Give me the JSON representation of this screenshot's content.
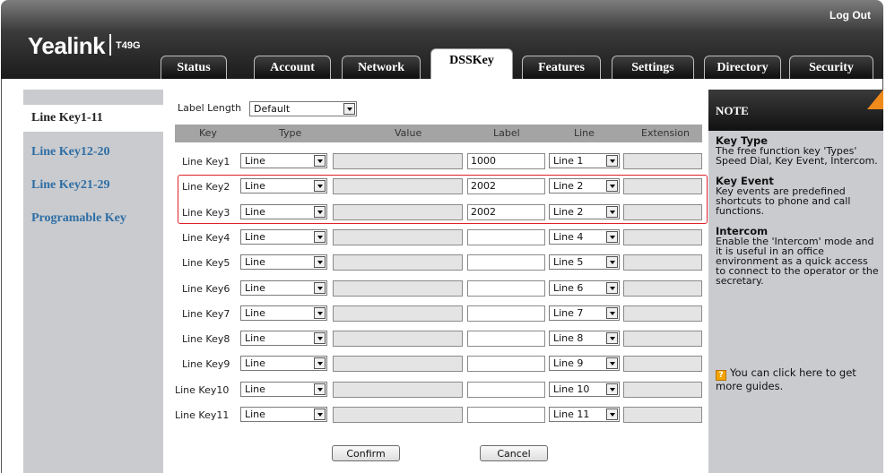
{
  "header": {
    "logo": "Yealink",
    "model": "T49G",
    "logout": "Log Out",
    "tabs": [
      {
        "label": "Status"
      },
      {
        "label": "Account"
      },
      {
        "label": "Network"
      },
      {
        "label": "DSSKey",
        "active": true
      },
      {
        "label": "Features"
      },
      {
        "label": "Settings"
      },
      {
        "label": "Directory"
      },
      {
        "label": "Security"
      }
    ]
  },
  "sidebar": {
    "items": [
      {
        "label": "Line Key1-11",
        "active": true
      },
      {
        "label": "Line Key12-20"
      },
      {
        "label": "Line Key21-29"
      },
      {
        "label": "Programable Key"
      }
    ]
  },
  "form": {
    "label_length_label": "Label Length",
    "label_length_value": "Default",
    "columns": [
      "Key",
      "Type",
      "Value",
      "Label",
      "Line",
      "Extension"
    ],
    "rows": [
      {
        "key": "Line Key1",
        "type": "Line",
        "value": "",
        "label": "1000",
        "line": "Line 1",
        "extension": ""
      },
      {
        "key": "Line Key2",
        "type": "Line",
        "value": "",
        "label": "2002",
        "line": "Line 2",
        "extension": ""
      },
      {
        "key": "Line Key3",
        "type": "Line",
        "value": "",
        "label": "2002",
        "line": "Line 2",
        "extension": ""
      },
      {
        "key": "Line Key4",
        "type": "Line",
        "value": "",
        "label": "",
        "line": "Line 4",
        "extension": ""
      },
      {
        "key": "Line Key5",
        "type": "Line",
        "value": "",
        "label": "",
        "line": "Line 5",
        "extension": ""
      },
      {
        "key": "Line Key6",
        "type": "Line",
        "value": "",
        "label": "",
        "line": "Line 6",
        "extension": ""
      },
      {
        "key": "Line Key7",
        "type": "Line",
        "value": "",
        "label": "",
        "line": "Line 7",
        "extension": ""
      },
      {
        "key": "Line Key8",
        "type": "Line",
        "value": "",
        "label": "",
        "line": "Line 8",
        "extension": ""
      },
      {
        "key": "Line Key9",
        "type": "Line",
        "value": "",
        "label": "",
        "line": "Line 9",
        "extension": ""
      },
      {
        "key": "Line Key10",
        "type": "Line",
        "value": "",
        "label": "",
        "line": "Line 10",
        "extension": ""
      },
      {
        "key": "Line Key11",
        "type": "Line",
        "value": "",
        "label": "",
        "line": "Line 11",
        "extension": ""
      }
    ],
    "confirm": "Confirm",
    "cancel": "Cancel"
  },
  "note": {
    "title": "NOTE",
    "sections": [
      {
        "heading": "Key Type",
        "text": "The free function key 'Types' Speed Dial, Key Event, Intercom."
      },
      {
        "heading": "Key Event",
        "text": "Key events are predefined shortcuts to phone and call functions."
      },
      {
        "heading": "Intercom",
        "text": "Enable the 'Intercom' mode and it is useful in an office environment as a quick access to connect to the operator or the secretary."
      }
    ],
    "guide": "You can click here to get more guides."
  },
  "colors": {
    "highlight": "#e0202a",
    "nav_link": "#2e6ea4",
    "note_corner": "#f08a1a"
  }
}
